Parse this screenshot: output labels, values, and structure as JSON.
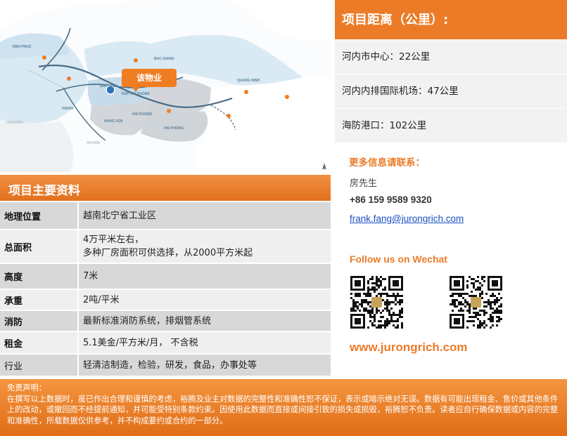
{
  "map": {
    "property_tag": "该物业",
    "labels": {
      "vinh_phuc": "VINH PHUC",
      "hanoi": "HANOI",
      "hoa_binh": "HOA BINH",
      "ha_nam": "HA NAM",
      "bac_giang": "BAC GIANG",
      "bac_ninh": "BAC NINH",
      "vsip": "VSIP HAI DUONG",
      "quang_ninh": "QUANG NINH",
      "hai_duong": "HAI DUONG",
      "hung_yen": "HUNG YEN",
      "hai_phong": "HAI PHONG"
    },
    "colors": {
      "province": "#d9eaf4",
      "province_dark": "#c6dcea",
      "gray_region": "#d2d6da",
      "road": "#4a6b86",
      "sea": "#ffffff"
    }
  },
  "distance": {
    "title": "项目距离（公里）:",
    "rows": [
      "河内市中心：22公里",
      "河内内排国际机场：47公里",
      "海防港口：102公里"
    ]
  },
  "contact": {
    "title": "更多信息请联系：",
    "name": "房先生",
    "phone": "+86 159 9589 9320",
    "email": "frank.fang@jurongrich.com",
    "follow": "Follow us on Wechat",
    "website": "www.jurongrich.com"
  },
  "info": {
    "title": "项目主要资料",
    "rows": [
      {
        "key": "地理位置",
        "value": "越南北宁省工业区",
        "value2": ""
      },
      {
        "key": "总面积",
        "value": "4万平米左右，",
        "value2": "多种厂房面积可供选择，从2000平方米起"
      },
      {
        "key": "高度",
        "value": "7米",
        "value2": ""
      },
      {
        "key": "承重",
        "value": "2吨/平米",
        "value2": ""
      },
      {
        "key": "消防",
        "value": "最新标准消防系统，排烟管系统",
        "value2": ""
      },
      {
        "key": "租金",
        "value": "5.1美金/平方米/月， 不含税",
        "value2": ""
      },
      {
        "key": "行业",
        "value": "轻清洁制造，检验，研发，食品，办事处等",
        "value2": ""
      }
    ]
  },
  "disclaimer": {
    "title": "免责声明：",
    "text": "在撰写以上数据时，虽已作出合理和谨慎的考虑，裕腾及业主对数据的完整性和准确性恕不保证，表示或暗示绝对无误。数据有可能出现租金、售价或其他条件上的改动，或撤回而不经提前通知，并可能受特别条款约束。因使用此数据而直接或间接引致的损失或损毁，裕腾恕不负责。读者应自行确保数据或内容的完整和准确性，所载数据仅供参考，并不构成要约或合约的一部分。"
  },
  "theme": {
    "accent": "#ec7b28",
    "row_dark": "#d8d8d8",
    "row_light": "#efefef",
    "link": "#1a4ec2"
  }
}
